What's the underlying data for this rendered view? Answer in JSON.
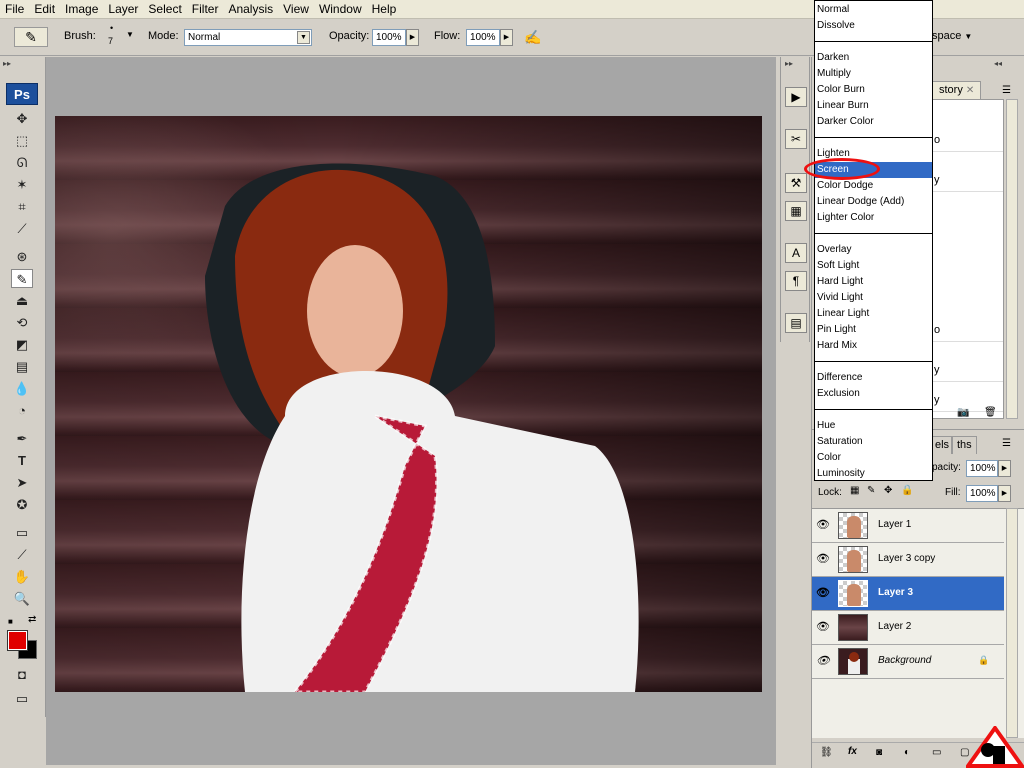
{
  "menu": [
    "File",
    "Edit",
    "Image",
    "Layer",
    "Select",
    "Filter",
    "Analysis",
    "View",
    "Window",
    "Help"
  ],
  "options": {
    "brush_label": "Brush:",
    "brush_size": "7",
    "mode_label": "Mode:",
    "mode_value": "Normal",
    "opacity_label": "Opacity:",
    "opacity_value": "100%",
    "flow_label": "Flow:",
    "flow_value": "100%",
    "workspace_label": "space"
  },
  "app_badge": "Ps",
  "blend_modes": {
    "groups": [
      [
        "Normal",
        "Dissolve"
      ],
      [
        "Darken",
        "Multiply",
        "Color Burn",
        "Linear Burn",
        "Darker Color"
      ],
      [
        "Lighten",
        "Screen",
        "Color Dodge",
        "Linear Dodge (Add)",
        "Lighter Color"
      ],
      [
        "Overlay",
        "Soft Light",
        "Hard Light",
        "Vivid Light",
        "Linear Light",
        "Pin Light",
        "Hard Mix"
      ],
      [
        "Difference",
        "Exclusion"
      ],
      [
        "Hue",
        "Saturation",
        "Color",
        "Luminosity"
      ]
    ],
    "selected": "Screen"
  },
  "history_panel": {
    "tab": "story",
    "rows": [
      "o",
      "y",
      "y",
      "o",
      "y",
      "y"
    ]
  },
  "layers_panel": {
    "tabs": [
      "els",
      "ths"
    ],
    "opacity_label": "pacity:",
    "opacity_value": "100%",
    "lock_label": "Lock:",
    "fill_label": "Fill:",
    "fill_value": "100%",
    "layers": [
      {
        "name": "Layer 1",
        "active": false,
        "thumb": "portrait"
      },
      {
        "name": "Layer 3 copy",
        "active": false,
        "thumb": "portrait"
      },
      {
        "name": "Layer 3",
        "active": true,
        "thumb": "portrait"
      },
      {
        "name": "Layer 2",
        "active": false,
        "thumb": "dark"
      },
      {
        "name": "Background",
        "active": false,
        "thumb": "portrait",
        "locked": true
      }
    ]
  },
  "colors": {
    "foreground": "#e00000",
    "background": "#000000",
    "selection": "#316ac5",
    "annotation": "#e11111"
  }
}
